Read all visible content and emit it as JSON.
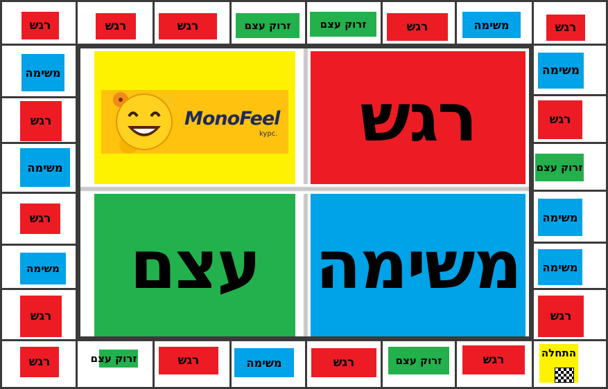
{
  "board": {
    "cells": [
      {
        "label": "רגש",
        "color": "red"
      },
      {
        "label": "רגש",
        "color": "red"
      },
      {
        "label": "רגש",
        "color": "red"
      },
      {
        "label": "זרוק עצם",
        "color": "green"
      },
      {
        "label": "זרוק עצם",
        "color": "green"
      },
      {
        "label": "רגש",
        "color": "red"
      },
      {
        "label": "משימה",
        "color": "blue"
      },
      {
        "label": "רגש",
        "color": "red"
      },
      {
        "label": "משימה",
        "color": "blue"
      },
      {
        "label": "רגש",
        "color": "red"
      },
      {
        "label": "זרוק עצם",
        "color": "green"
      },
      {
        "label": "משימה",
        "color": "blue"
      },
      {
        "label": "משימה",
        "color": "blue"
      },
      {
        "label": "רגש",
        "color": "red"
      },
      {
        "label": "התחלה",
        "color": "yellow"
      },
      {
        "label": "רגש",
        "color": "red"
      },
      {
        "label": "זרוק עצם",
        "color": "green"
      },
      {
        "label": "רגש",
        "color": "red"
      },
      {
        "label": "משימה",
        "color": "blue"
      },
      {
        "label": "רגש",
        "color": "red"
      },
      {
        "label": "זרוק עצם",
        "color": "green"
      },
      {
        "label": "רגש",
        "color": "red"
      },
      {
        "label": "רגש",
        "color": "red"
      },
      {
        "label": "משימה",
        "color": "blue"
      },
      {
        "label": "רגש",
        "color": "red"
      },
      {
        "label": "משימה",
        "color": "blue"
      },
      {
        "label": "רגש",
        "color": "red"
      },
      {
        "label": "משימה",
        "color": "blue"
      }
    ]
  },
  "center": {
    "feelings_label": "רגש",
    "task_label": "משימה",
    "bone_label": "עצם",
    "logo_text": "MonoFeel",
    "logo_sub": ".kypc"
  },
  "colors": {
    "red": "#ed1c24",
    "blue": "#00a2e8",
    "green": "#22b14c",
    "yellow": "#fff200",
    "logo_orange": "#ffc20e"
  },
  "icons": {
    "start_icon": "checkered-flag-icon",
    "logo_icon": "smiley-emoji-icon"
  }
}
